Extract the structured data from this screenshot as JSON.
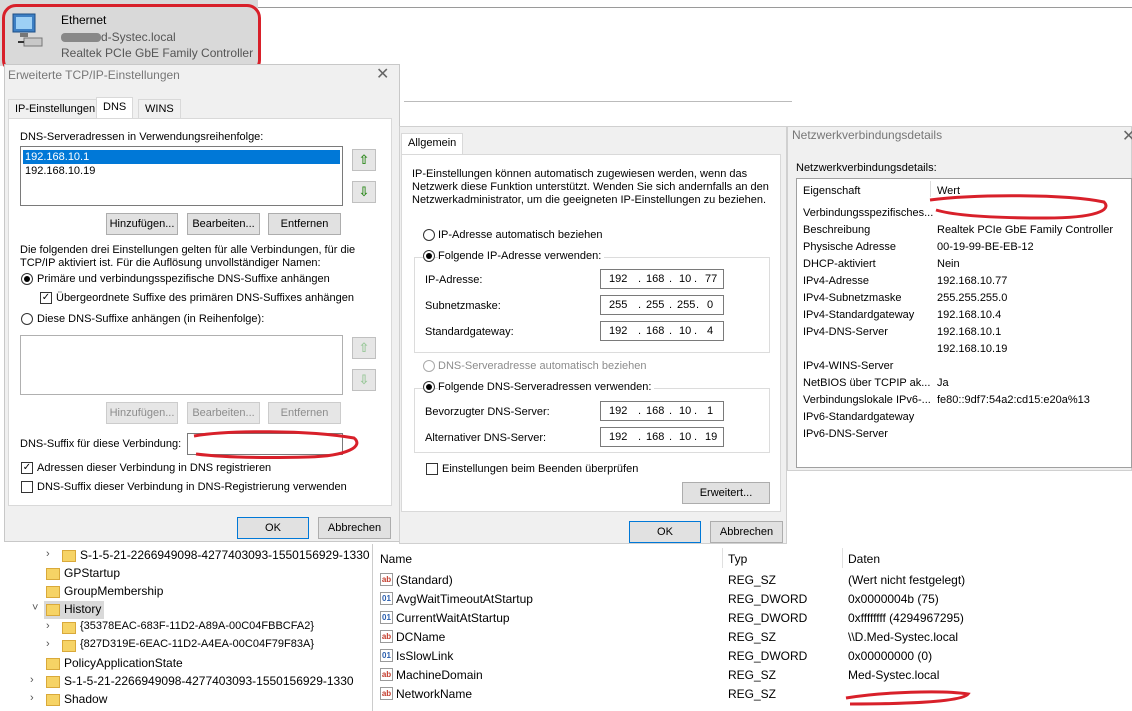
{
  "adapter": {
    "name": "Ethernet",
    "domain": "d-Systec.local",
    "device": "Realtek PCIe GbE Family Controller"
  },
  "tcpip_dialog": {
    "title": "Erweiterte TCP/IP-Einstellungen",
    "tabs": [
      "IP-Einstellungen",
      "DNS",
      "WINS"
    ],
    "dns_list_label": "DNS-Serveradressen in Verwendungsreihenfolge:",
    "dns_servers": [
      "192.168.10.1",
      "192.168.10.19"
    ],
    "btn_add": "Hinzufügen...",
    "btn_edit": "Bearbeiten...",
    "btn_remove": "Entfernen",
    "info_text_1": "Die folgenden drei Einstellungen gelten für alle Verbindungen, für die",
    "info_text_2": "TCP/IP aktiviert ist. Für die Auflösung unvollständiger Namen:",
    "radio_primary": "Primäre und verbindungsspezifische DNS-Suffixe anhängen",
    "chk_parent": "Übergeordnete Suffixe des primären DNS-Suffixes anhängen",
    "radio_these": "Diese DNS-Suffixe anhängen (in Reihenfolge):",
    "suffix_label": "DNS-Suffix für diese Verbindung:",
    "chk_register": "Adressen dieser Verbindung in DNS registrieren",
    "chk_use_suffix": "DNS-Suffix dieser Verbindung in DNS-Registrierung verwenden",
    "ok": "OK",
    "cancel": "Abbrechen"
  },
  "ipv4_dialog": {
    "tab": "Allgemein",
    "intro_1": "IP-Einstellungen können automatisch zugewiesen werden, wenn das",
    "intro_2": "Netzwerk diese Funktion unterstützt. Wenden Sie sich andernfalls an den",
    "intro_3": "Netzwerkadministrator, um die geeigneten IP-Einstellungen zu beziehen.",
    "radio_auto_ip": "IP-Adresse automatisch beziehen",
    "radio_static_ip": "Folgende IP-Adresse verwenden:",
    "ip_label": "IP-Adresse:",
    "mask_label": "Subnetzmaske:",
    "gw_label": "Standardgateway:",
    "ip": [
      "192",
      "168",
      "10",
      "77"
    ],
    "mask": [
      "255",
      "255",
      "255",
      "0"
    ],
    "gateway": [
      "192",
      "168",
      "10",
      "4"
    ],
    "radio_auto_dns": "DNS-Serveradresse automatisch beziehen",
    "radio_static_dns": "Folgende DNS-Serveradressen verwenden:",
    "pref_dns_label": "Bevorzugter DNS-Server:",
    "alt_dns_label": "Alternativer DNS-Server:",
    "pref_dns": [
      "192",
      "168",
      "10",
      "1"
    ],
    "alt_dns": [
      "192",
      "168",
      "10",
      "19"
    ],
    "chk_validate": "Einstellungen beim Beenden überprüfen",
    "advanced": "Erweitert...",
    "ok": "OK",
    "cancel": "Abbrechen"
  },
  "details_dialog": {
    "title": "Netzwerkverbindungsdetails",
    "label": "Netzwerkverbindungsdetails:",
    "col_property": "Eigenschaft",
    "col_value": "Wert",
    "rows": [
      [
        "Verbindungsspezifisches...",
        ""
      ],
      [
        "Beschreibung",
        "Realtek PCIe GbE Family Controller"
      ],
      [
        "Physische Adresse",
        "00-19-99-BE-EB-12"
      ],
      [
        "DHCP-aktiviert",
        "Nein"
      ],
      [
        "IPv4-Adresse",
        "192.168.10.77"
      ],
      [
        "IPv4-Subnetzmaske",
        "255.255.255.0"
      ],
      [
        "IPv4-Standardgateway",
        "192.168.10.4"
      ],
      [
        "IPv4-DNS-Server",
        "192.168.10.1"
      ],
      [
        "",
        "192.168.10.19"
      ],
      [
        "IPv4-WINS-Server",
        ""
      ],
      [
        "NetBIOS über TCPIP ak...",
        "Ja"
      ],
      [
        "Verbindungslokale IPv6-...",
        "fe80::9df7:54a2:cd15:e20a%13"
      ],
      [
        "IPv6-Standardgateway",
        ""
      ],
      [
        "IPv6-DNS-Server",
        ""
      ]
    ]
  },
  "registry_tree": [
    {
      "label": "S-1-5-21-2266949098-4277403093-1550156929-1330",
      "expander": "›"
    },
    {
      "label": "GPStartup",
      "expander": ""
    },
    {
      "label": "GroupMembership",
      "expander": ""
    },
    {
      "label": "History",
      "expander": "˅"
    },
    {
      "label": "{35378EAC-683F-11D2-A89A-00C04FBBCFA2}",
      "expander": "›"
    },
    {
      "label": "{827D319E-6EAC-11D2-A4EA-00C04F79F83A}",
      "expander": "›"
    },
    {
      "label": "PolicyApplicationState",
      "expander": ""
    },
    {
      "label": "S-1-5-21-2266949098-4277403093-1550156929-1330",
      "expander": "›"
    },
    {
      "label": "Shadow",
      "expander": "›"
    }
  ],
  "registry_values": {
    "col_name": "Name",
    "col_type": "Typ",
    "col_data": "Daten",
    "rows": [
      {
        "icon": "ab",
        "name": "(Standard)",
        "type": "REG_SZ",
        "data": "(Wert nicht festgelegt)"
      },
      {
        "icon": "dw",
        "name": "AvgWaitTimeoutAtStartup",
        "type": "REG_DWORD",
        "data": "0x0000004b (75)"
      },
      {
        "icon": "dw",
        "name": "CurrentWaitAtStartup",
        "type": "REG_DWORD",
        "data": "0xffffffff (4294967295)"
      },
      {
        "icon": "ab",
        "name": "DCName",
        "type": "REG_SZ",
        "data": "\\\\D.Med-Systec.local"
      },
      {
        "icon": "dw",
        "name": "IsSlowLink",
        "type": "REG_DWORD",
        "data": "0x00000000 (0)"
      },
      {
        "icon": "ab",
        "name": "MachineDomain",
        "type": "REG_SZ",
        "data": "Med-Systec.local"
      },
      {
        "icon": "ab",
        "name": "NetworkName",
        "type": "REG_SZ",
        "data": ""
      }
    ]
  }
}
